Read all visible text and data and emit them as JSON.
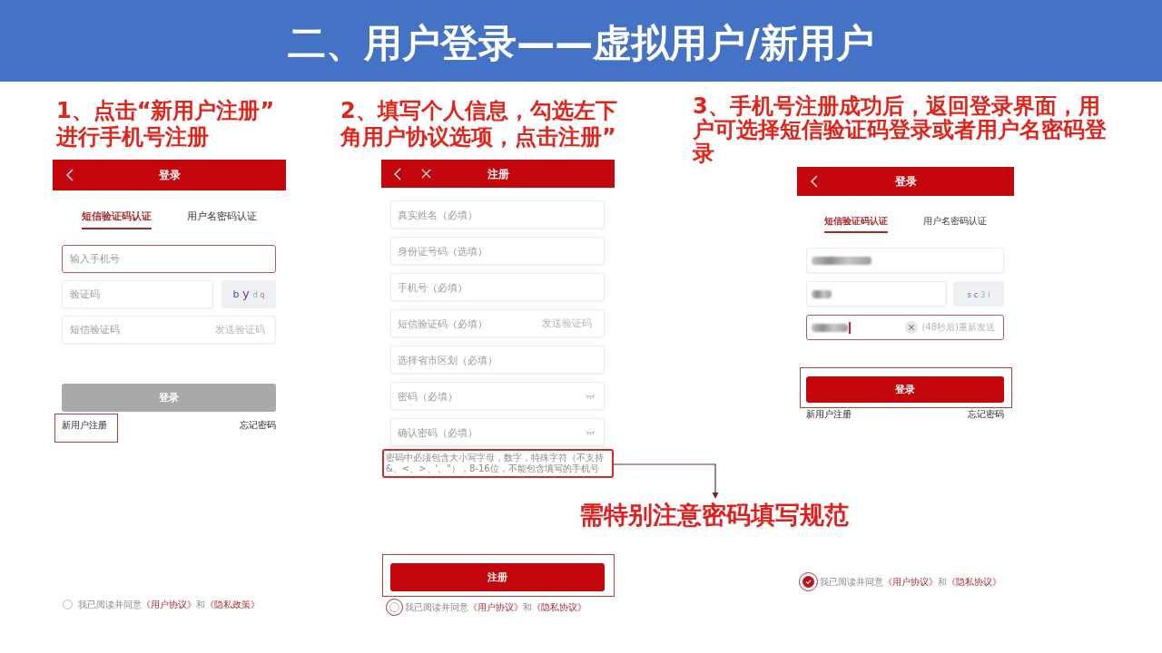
{
  "title": "二、用户登录——虚拟用户/新用户",
  "steps": [
    {
      "caption": "1、点击“新用户注册”进行手机号注册",
      "screen": {
        "kind": "login",
        "title": "登录",
        "close_button": false,
        "tabs": [
          {
            "label": "短信验证码认证",
            "selected": true
          },
          {
            "label": "用户名密码认证",
            "selected": false
          }
        ],
        "fields": [
          {
            "kind": "text",
            "placeholder": "输入手机号",
            "focused": true
          },
          {
            "kind": "captcha",
            "placeholder": "验证码",
            "captcha": "b y d q",
            "focused": false
          },
          {
            "kind": "code",
            "placeholder": "短信验证码",
            "action": "发送验证码",
            "focused": false
          }
        ],
        "submit": {
          "label": "登录",
          "disabled": true,
          "highlighted": false
        },
        "links": [
          {
            "label": "新用户注册",
            "highlighted": true
          },
          {
            "label": "忘记密码",
            "highlighted": false
          }
        ],
        "agreement": {
          "checked": false,
          "highlighted": false,
          "parts": [
            {
              "kind": "plain",
              "text": "我已阅读并同意"
            },
            {
              "kind": "link",
              "text": "《用户协议》"
            },
            {
              "kind": "plain",
              "text": "和"
            },
            {
              "kind": "link",
              "text": "《隐私政策》"
            }
          ]
        }
      }
    },
    {
      "caption": "2、填写个人信息，勾选左下角用户协议选项，点击注册”",
      "screen": {
        "kind": "register",
        "title": "注册",
        "close_button": true,
        "fields": [
          {
            "kind": "text",
            "placeholder": "真实姓名（必填）",
            "focused": false
          },
          {
            "kind": "text",
            "placeholder": "身份证号码（选填）",
            "focused": false
          },
          {
            "kind": "text",
            "placeholder": "手机号（必填）",
            "focused": false
          },
          {
            "kind": "code",
            "placeholder": "短信验证码（必填）",
            "action": "发送验证码",
            "focused": false
          },
          {
            "kind": "text",
            "placeholder": "选择省市区划（必填）",
            "focused": false
          },
          {
            "kind": "password",
            "placeholder": "密码（必填）",
            "focused": false
          },
          {
            "kind": "password",
            "placeholder": "确认密码（必填）",
            "focused": false
          }
        ],
        "hint": {
          "text": "密码中必须包含大小写字母，数字，特殊字符（不支持&、<、>、'、\"），8-16位，不能包含填写的手机号",
          "highlighted": true,
          "callout": "需特别注意密码填写规范"
        },
        "submit": {
          "label": "注册",
          "disabled": false,
          "highlighted": true
        },
        "agreement": {
          "checked": false,
          "highlighted": true,
          "parts": [
            {
              "kind": "plain",
              "text": "我已阅读并同意"
            },
            {
              "kind": "link",
              "text": "《用户协议》"
            },
            {
              "kind": "plain",
              "text": "和"
            },
            {
              "kind": "link",
              "text": "《隐私协议》"
            }
          ]
        }
      }
    },
    {
      "caption": "3、手机号注册成功后，返回登录界面，用户可选择短信验证码登录或者用户名密码登录",
      "screen": {
        "kind": "login",
        "title": "登录",
        "close_button": false,
        "tabs": [
          {
            "label": "短信验证码认证",
            "selected": true
          },
          {
            "label": "用户名密码认证",
            "selected": false
          }
        ],
        "fields": [
          {
            "kind": "text",
            "blurred": true,
            "focused": false,
            "clearable": false
          },
          {
            "kind": "captcha",
            "blurred": true,
            "captcha": "s c 3 i",
            "focused": false,
            "clearable": false
          },
          {
            "kind": "code",
            "blurred": true,
            "action": "(48秒后)重新发送",
            "focused": true,
            "clearable": true
          }
        ],
        "submit": {
          "label": "登录",
          "disabled": false,
          "highlighted": true
        },
        "links": [
          {
            "label": "新用户注册",
            "highlighted": false
          },
          {
            "label": "忘记密码",
            "highlighted": false
          }
        ],
        "agreement": {
          "checked": true,
          "highlighted": true,
          "parts": [
            {
              "kind": "plain",
              "text": "我已阅读并同意"
            },
            {
              "kind": "link",
              "text": "《用户协议》"
            },
            {
              "kind": "plain",
              "text": "和"
            },
            {
              "kind": "link",
              "text": "《隐私协议》"
            }
          ]
        }
      }
    }
  ]
}
